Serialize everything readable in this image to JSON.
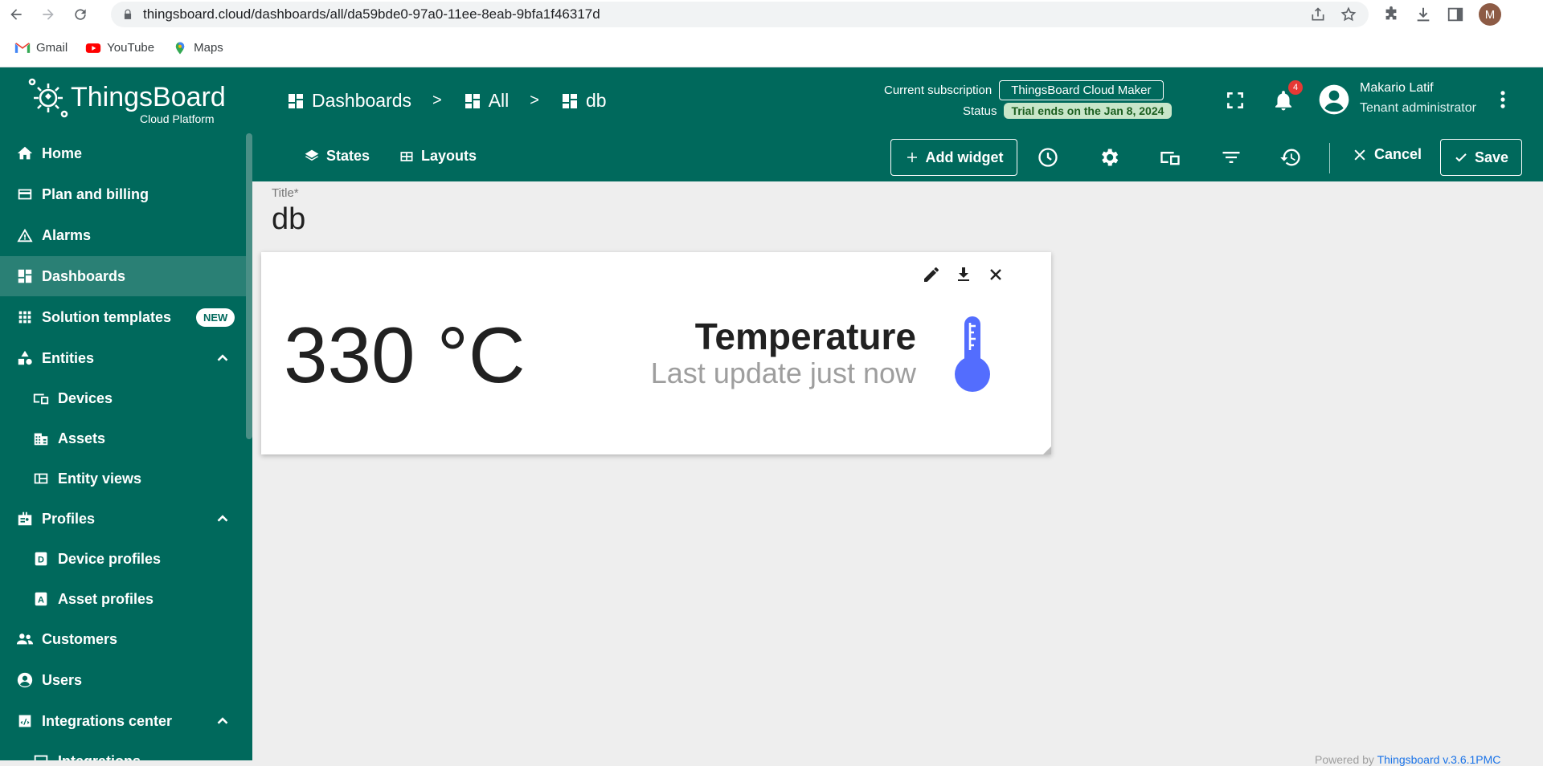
{
  "browser": {
    "url": "thingsboard.cloud/dashboards/all/da59bde0-97a0-11ee-8eab-9bfa1f46317d",
    "profile_initial": "M",
    "bookmarks": [
      {
        "label": "Gmail",
        "icon": "gmail-icon"
      },
      {
        "label": "YouTube",
        "icon": "youtube-icon"
      },
      {
        "label": "Maps",
        "icon": "maps-icon"
      }
    ]
  },
  "app": {
    "brand": "ThingsBoard",
    "brand_sub": "Cloud Platform",
    "breadcrumb": [
      "Dashboards",
      "All",
      "db"
    ],
    "breadcrumb_sep": ">",
    "subscription": {
      "label": "Current subscription",
      "plan": "ThingsBoard Cloud Maker",
      "status_label": "Status",
      "status_value": "Trial ends on the Jan 8, 2024"
    },
    "notifications_count": "4",
    "user": {
      "name": "Makario Latif",
      "role": "Tenant administrator"
    },
    "colors": {
      "primary": "#00695c",
      "accent": "#536dfe",
      "badge": "#e53935"
    }
  },
  "toolbar": {
    "states_label": "States",
    "layouts_label": "Layouts",
    "add_widget_label": "Add widget",
    "cancel_label": "Cancel",
    "save_label": "Save"
  },
  "sidebar": {
    "items": [
      {
        "label": "Home",
        "icon": "home-icon"
      },
      {
        "label": "Plan and billing",
        "icon": "billing-icon"
      },
      {
        "label": "Alarms",
        "icon": "alarm-icon"
      },
      {
        "label": "Dashboards",
        "icon": "dashboards-icon",
        "active": true
      },
      {
        "label": "Solution templates",
        "icon": "grid-icon",
        "badge": "NEW"
      },
      {
        "label": "Entities",
        "icon": "entities-icon",
        "expanded": true
      },
      {
        "label": "Devices",
        "icon": "devices-icon",
        "sub": true
      },
      {
        "label": "Assets",
        "icon": "assets-icon",
        "sub": true
      },
      {
        "label": "Entity views",
        "icon": "entity-views-icon",
        "sub": true
      },
      {
        "label": "Profiles",
        "icon": "profiles-icon",
        "expanded": true
      },
      {
        "label": "Device profiles",
        "icon": "device-profile-icon",
        "sub": true
      },
      {
        "label": "Asset profiles",
        "icon": "asset-profile-icon",
        "sub": true
      },
      {
        "label": "Customers",
        "icon": "customers-icon"
      },
      {
        "label": "Users",
        "icon": "users-icon"
      },
      {
        "label": "Integrations center",
        "icon": "integrations-icon",
        "expanded": true
      },
      {
        "label": "Integrations",
        "icon": "integrations-sub-icon",
        "sub": true
      }
    ]
  },
  "dashboard": {
    "title_label": "Title*",
    "title_value": "db",
    "widget": {
      "value": "330 °C",
      "label": "Temperature",
      "last_update": "Last update just now"
    }
  },
  "footer": {
    "prefix": "Powered by",
    "brand": "Thingsboard v.3.6.1PMC"
  }
}
